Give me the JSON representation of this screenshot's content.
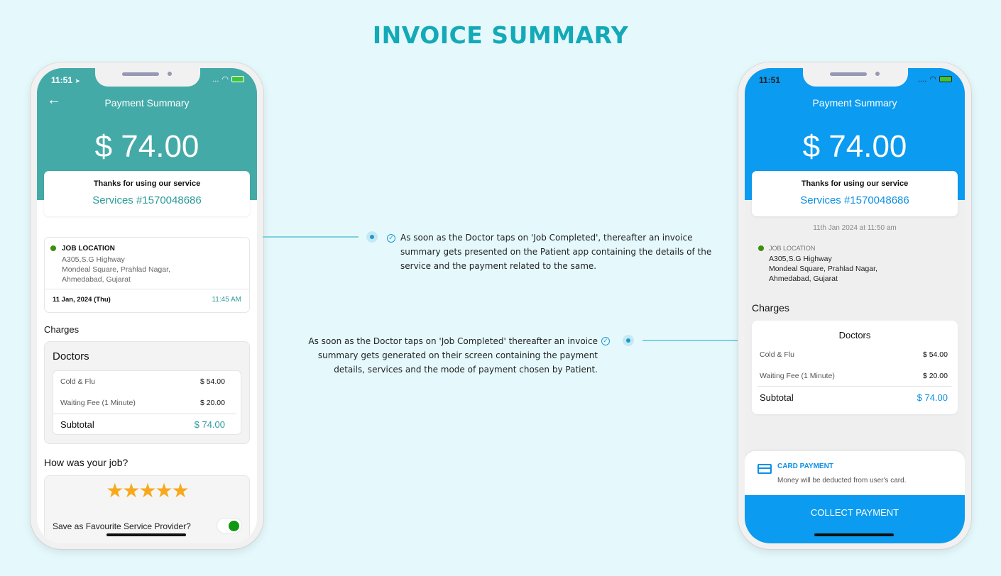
{
  "page": {
    "title": "INVOICE SUMMARY",
    "colors": {
      "title": "#14a9b7",
      "background": "#e5f9fd",
      "patient_accent": "#44aaa8",
      "doctor_accent": "#0b9bf0"
    }
  },
  "patient_phone": {
    "status": {
      "time": "11:51",
      "location_icon": "➤",
      "signal_icon": "...",
      "wifi_icon": "wifi-icon",
      "battery_icon": "battery-charging-icon"
    },
    "header": {
      "back_icon": "←",
      "title": "Payment Summary",
      "amount": "$ 74.00"
    },
    "thanks": {
      "text": "Thanks for using our service",
      "service_id": "Services #1570048686"
    },
    "location": {
      "title": "JOB LOCATION",
      "address_lines": [
        "A305,S.G Highway",
        "Mondeal Square, Prahlad Nagar,",
        "Ahmedabad, Gujarat"
      ],
      "date": "11 Jan, 2024 (Thu)",
      "time": "11:45 AM"
    },
    "charges": {
      "label": "Charges",
      "category": "Doctors",
      "items": [
        {
          "name": "Cold & Flu",
          "price": "$ 54.00"
        },
        {
          "name": "Waiting Fee (1 Minute)",
          "price": "$ 20.00"
        }
      ],
      "subtotal_label": "Subtotal",
      "subtotal_value": "$ 74.00"
    },
    "rating": {
      "question": "How was your job?",
      "stars": 5,
      "max_stars": 5,
      "star_glyph": "★",
      "favourite_label": "Save as Favourite Service Provider?",
      "favourite_enabled": true
    }
  },
  "doctor_phone": {
    "status": {
      "time": "11:51",
      "signal_icon": "....",
      "wifi_icon": "wifi-icon",
      "battery_icon": "battery-charging-icon"
    },
    "header": {
      "title": "Payment Summary",
      "amount": "$ 74.00"
    },
    "thanks": {
      "text": "Thanks for using our service",
      "service_id": "Services #1570048686"
    },
    "timestamp": "11th Jan 2024 at 11:50 am",
    "location": {
      "title": "JOB LOCATION",
      "address_lines": [
        "A305,S.G Highway",
        "Mondeal Square, Prahlad Nagar,",
        "Ahmedabad, Gujarat"
      ]
    },
    "charges": {
      "label": "Charges",
      "category": "Doctors",
      "items": [
        {
          "name": "Cold & Flu",
          "price": "$ 54.00"
        },
        {
          "name": "Waiting Fee (1 Minute)",
          "price": "$ 20.00"
        }
      ],
      "subtotal_label": "Subtotal",
      "subtotal_value": "$ 74.00"
    },
    "payment": {
      "method_title": "CARD PAYMENT",
      "method_desc": "Money will be deducted from user's card.",
      "button": "COLLECT PAYMENT"
    }
  },
  "annotations": {
    "patient_lines": [
      "As soon as the Doctor taps on 'Job Completed', thereafter an invoice",
      "summary gets presented on the Patient app containing the details of the",
      "service and the payment related to the same."
    ],
    "doctor_lines": [
      "As soon as the Doctor taps on 'Job Completed' thereafter an invoice",
      "summary gets generated on their screen containing the payment",
      "details, services and the mode of payment chosen by Patient."
    ],
    "check_glyph": "✓"
  }
}
